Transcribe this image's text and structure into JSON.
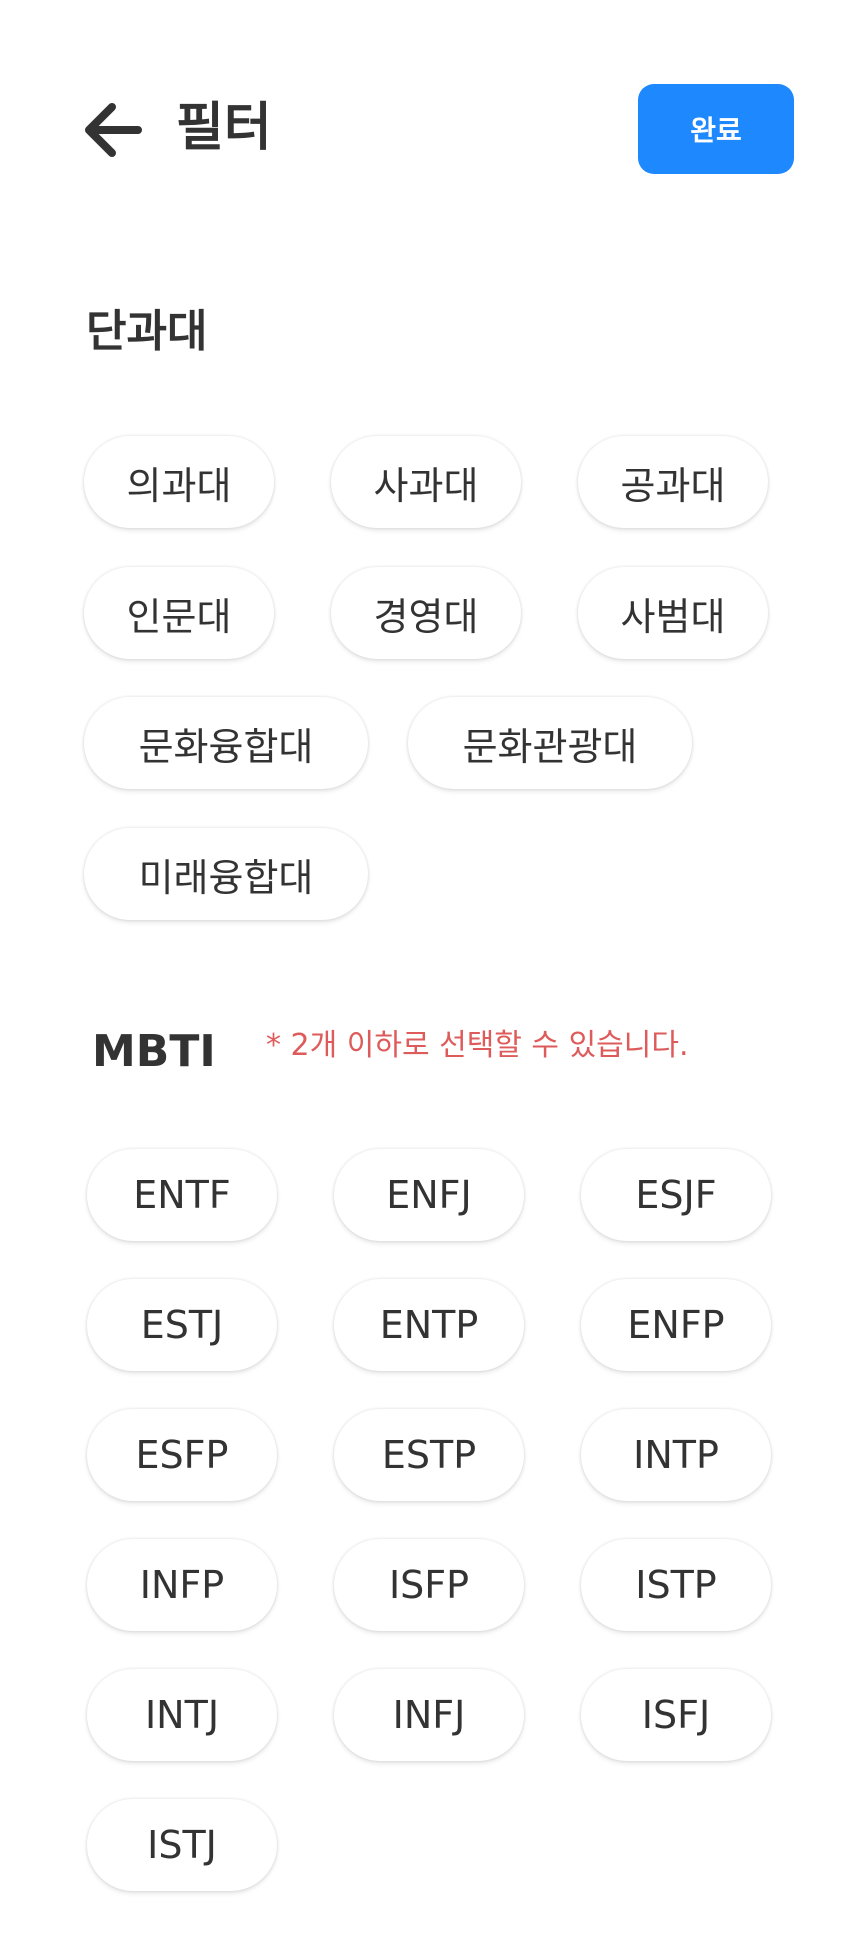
{
  "header": {
    "back_icon": "arrow-left-icon",
    "title": "필터",
    "done_label": "완료",
    "accent_color": "#1E88FF"
  },
  "college": {
    "title": "단과대",
    "options": [
      "의과대",
      "사과대",
      "공과대",
      "인문대",
      "경영대",
      "사범대",
      "문화융합대",
      "문화관광대",
      "미래융합대"
    ]
  },
  "mbti": {
    "title": "MBTI",
    "note": "* 2개 이하로 선택할 수 있습니다.",
    "note_color": "#DE5B5B",
    "options": [
      "ENTF",
      "ENFJ",
      "ESJF",
      "ESTJ",
      "ENTP",
      "ENFP",
      "ESFP",
      "ESTP",
      "INTP",
      "INFP",
      "ISFP",
      "ISTP",
      "INTJ",
      "INFJ",
      "ISFJ",
      "ISTJ"
    ]
  }
}
